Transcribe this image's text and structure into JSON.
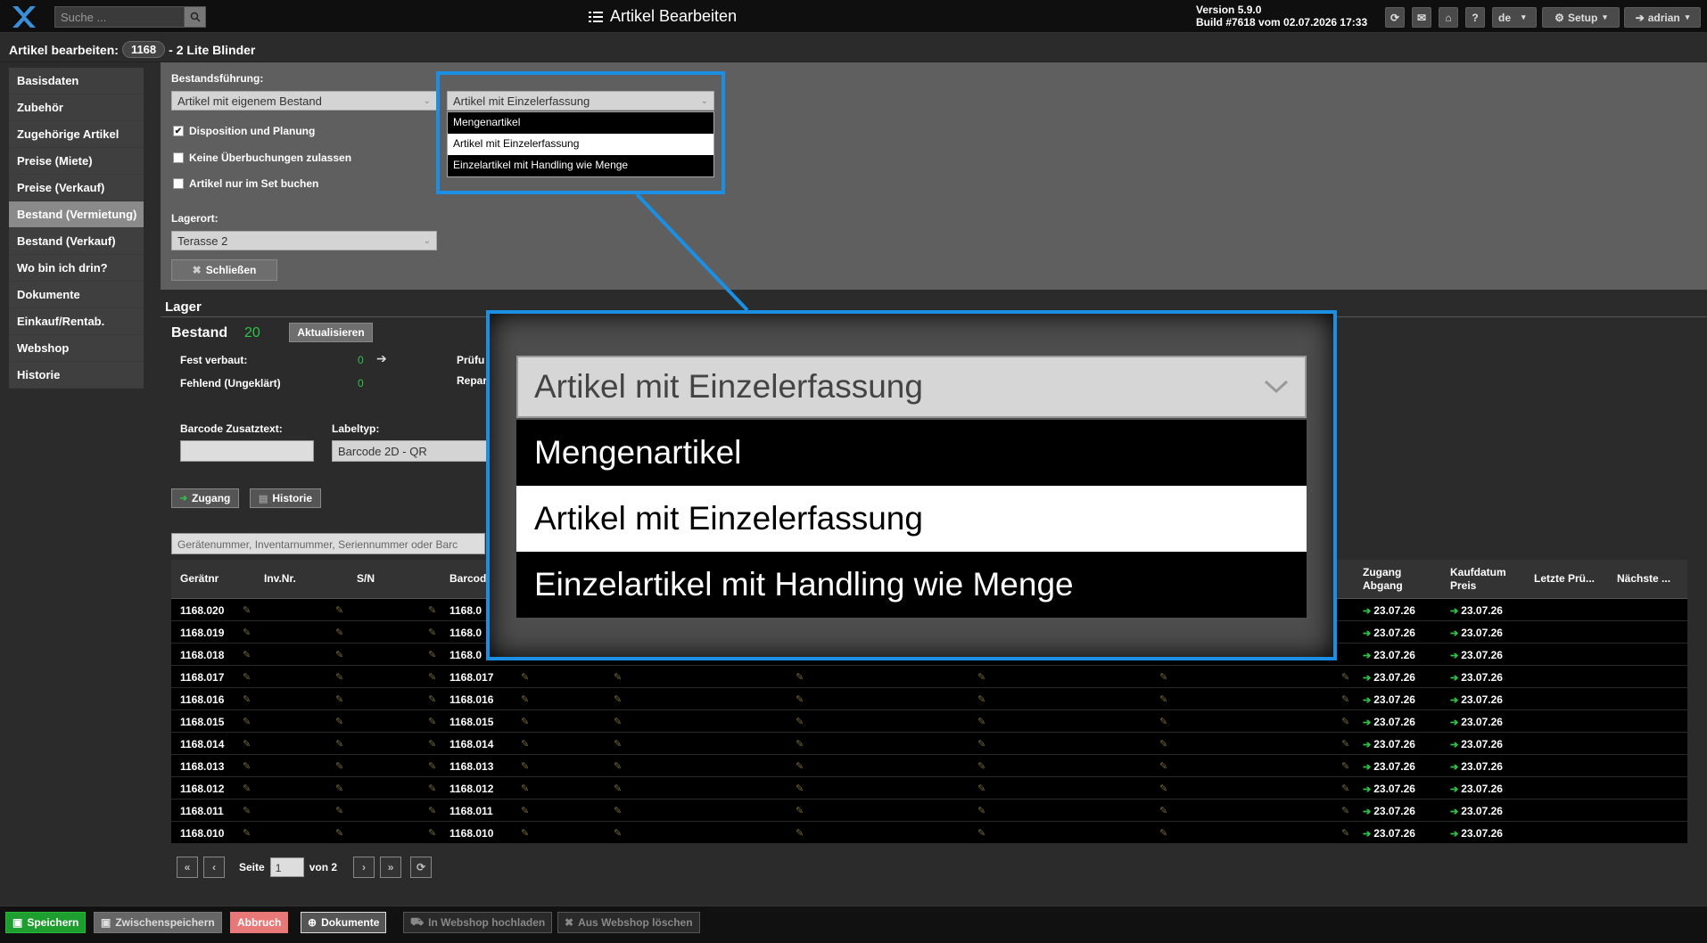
{
  "topbar": {
    "search_placeholder": "Suche ...",
    "title": "Artikel Bearbeiten",
    "version": "Version 5.9.0",
    "build": "Build #7618 vom 02.07.2026 17:33",
    "lang": "de",
    "setup": "Setup",
    "user": "adrian",
    "help": "?"
  },
  "page": {
    "title_prefix": "Artikel bearbeiten:",
    "article_no": "1168",
    "title_suffix": "- 2 Lite Blinder"
  },
  "sidebar": {
    "items": [
      "Basisdaten",
      "Zubehör",
      "Zugehörige Artikel",
      "Preise (Miete)",
      "Preise (Verkauf)",
      "Bestand (Vermietung)",
      "Bestand (Verkauf)",
      "Wo bin ich drin?",
      "Dokumente",
      "Einkauf/Rentab.",
      "Webshop",
      "Historie"
    ],
    "active_index": 5
  },
  "form": {
    "bestand_label": "Bestandsführung:",
    "bestand_value": "Artikel mit eigenem Bestand",
    "erfassung_value": "Artikel mit Einzelerfassung",
    "dispo_label": "Disposition und Planung",
    "dispo_checked": true,
    "keine_label": "Keine Überbuchungen zulassen",
    "set_label": "Artikel nur im Set buchen",
    "lagerort_label": "Lagerort:",
    "lagerort_value": "Terasse 2",
    "close_btn": "Schließen"
  },
  "dropdown": {
    "options": [
      "Mengenartikel",
      "Artikel mit Einzelerfassung",
      "Einzelartikel mit Handling wie Menge"
    ],
    "selected_index": 1
  },
  "lager": {
    "title": "Lager",
    "bestand_label": "Bestand",
    "bestand_value": "20",
    "refresh_btn": "Aktualisieren",
    "fest_label": "Fest verbaut:",
    "fest_value": "0",
    "fehlend_label": "Fehlend (Ungeklärt)",
    "fehlend_value": "0",
    "pruef_label": "Prüfu",
    "repar_label": "Repar",
    "barcode_label": "Barcode Zusatztext:",
    "labeltyp_label": "Labeltyp:",
    "labeltyp_value": "Barcode 2D - QR",
    "zugang_btn": "Zugang",
    "historie_btn": "Historie",
    "filter_placeholder": "Gerätenummer, Inventarnummer, Seriennummer oder Barc"
  },
  "table": {
    "headers": {
      "geraetnr": "Gerätnr",
      "invnr": "Inv.Nr.",
      "sn": "S/N",
      "barcode": "Barcod",
      "zugang": "Zugang",
      "abgang": "Abgang",
      "kaufdatum": "Kaufdatum",
      "preis": "Preis",
      "letzte": "Letzte Prü...",
      "naechste": "Nächste ..."
    },
    "rows": [
      {
        "nr": "1168.020",
        "barcode": "1168.0",
        "zugang": "23.07.26",
        "kauf": "23.07.26"
      },
      {
        "nr": "1168.019",
        "barcode": "1168.0",
        "zugang": "23.07.26",
        "kauf": "23.07.26"
      },
      {
        "nr": "1168.018",
        "barcode": "1168.0",
        "zugang": "23.07.26",
        "kauf": "23.07.26"
      },
      {
        "nr": "1168.017",
        "barcode": "1168.017",
        "zugang": "23.07.26",
        "kauf": "23.07.26"
      },
      {
        "nr": "1168.016",
        "barcode": "1168.016",
        "zugang": "23.07.26",
        "kauf": "23.07.26"
      },
      {
        "nr": "1168.015",
        "barcode": "1168.015",
        "zugang": "23.07.26",
        "kauf": "23.07.26"
      },
      {
        "nr": "1168.014",
        "barcode": "1168.014",
        "zugang": "23.07.26",
        "kauf": "23.07.26"
      },
      {
        "nr": "1168.013",
        "barcode": "1168.013",
        "zugang": "23.07.26",
        "kauf": "23.07.26"
      },
      {
        "nr": "1168.012",
        "barcode": "1168.012",
        "zugang": "23.07.26",
        "kauf": "23.07.26"
      },
      {
        "nr": "1168.011",
        "barcode": "1168.011",
        "zugang": "23.07.26",
        "kauf": "23.07.26"
      },
      {
        "nr": "1168.010",
        "barcode": "1168.010",
        "zugang": "23.07.26",
        "kauf": "23.07.26"
      }
    ]
  },
  "pager": {
    "seite_label": "Seite",
    "page": "1",
    "von_label": "von 2"
  },
  "footer": {
    "save": "Speichern",
    "interim": "Zwischenspeichern",
    "cancel": "Abbruch",
    "docs": "Dokumente",
    "upload": "In Webshop hochladen",
    "delete": "Aus Webshop löschen"
  },
  "colors": {
    "accent": "#1a8fe3",
    "green": "#2ec24a",
    "save": "#1e9e2e",
    "cancel": "#e87878"
  },
  "icons": [
    "logo-icon",
    "search-icon",
    "list-icon",
    "refresh-icon",
    "mail-icon",
    "home-icon",
    "gear-icon",
    "user-icon",
    "pencil-icon",
    "arrow-in-icon",
    "close-icon",
    "check-icon",
    "chevron-down-icon"
  ]
}
